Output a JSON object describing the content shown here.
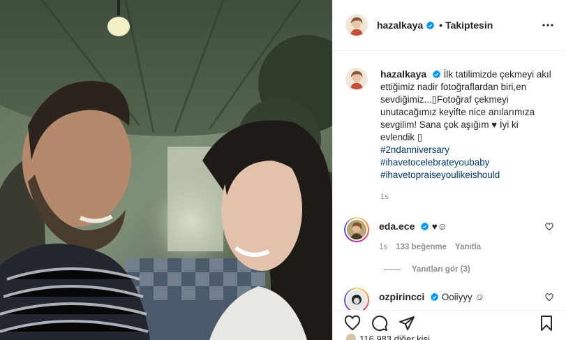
{
  "colors": {
    "link": "#00376b",
    "verified": "#0095f6",
    "muted": "#8e8e8e",
    "text": "#262626",
    "border": "#efefef"
  },
  "header": {
    "username": "hazalkaya",
    "separator": "•",
    "follow_status": "Takiptesin",
    "more_icon": "ellipsis-icon"
  },
  "caption": {
    "username": "hazalkaya",
    "text": "İlk tatilimizde çekmeyi akıl ettiğimiz nadir fotoğraflardan biri,en sevdiğimiz...▯Fotoğraf çekmeyi unutacağımız keyifte nice anılarımıza sevgilim! Sana çok aşığım ♥ İyi ki evlendik ▯",
    "hashtags": [
      "#2ndanniversary",
      "#ihavetocelebrateyoubaby",
      "#ihavetopraiseyoulikeishould"
    ],
    "time": "1s"
  },
  "comments": [
    {
      "username": "eda.ece",
      "text": "♥☺",
      "time": "1s",
      "likes": "133 beğenme",
      "reply": "Yanıtla"
    },
    {
      "username": "ozpirincci",
      "text": "Ooiiyyy ☺"
    }
  ],
  "view_replies": "Yanıtları gör (3)",
  "actions": {
    "like_icon": "heart-icon",
    "comment_icon": "comment-icon",
    "share_icon": "send-icon",
    "save_icon": "bookmark-icon"
  },
  "likes_partial": "116.983 diğer kişi"
}
